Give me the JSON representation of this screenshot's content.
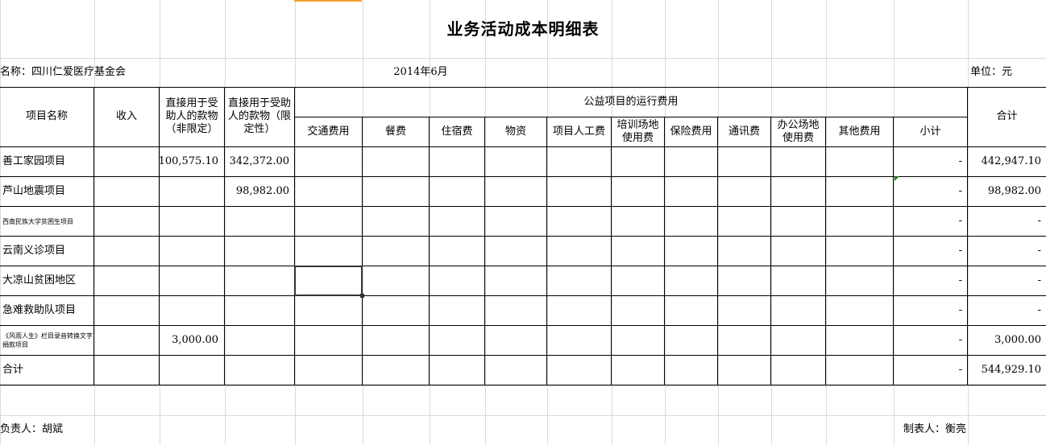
{
  "title": "业务活动成本明细表",
  "org_label": "名称：四川仁爱医疗基金会",
  "period": "2014年6月",
  "unit_label": "单位：元",
  "headers": {
    "project_name": "项目名称",
    "income": "收入",
    "direct_unrestricted": "直接用于受助人的款物（非限定）",
    "direct_restricted": "直接用于受助人的款物（限定性）",
    "operating_group": "公益项目的运行费用",
    "total": "合计",
    "sub": [
      "交通费用",
      "餐费",
      "住宿费",
      "物资",
      "项目人工费",
      "培训场地使用费",
      "保险费用",
      "通讯费",
      "办公场地使用费",
      "其他费用",
      "小计"
    ]
  },
  "rows": [
    {
      "name": "善工家园项目",
      "small": false,
      "direct_unrestricted": "100,575.10",
      "direct_restricted": "342,372.00",
      "subtotal": "-",
      "total": "442,947.10"
    },
    {
      "name": "芦山地震项目",
      "small": false,
      "direct_unrestricted": "",
      "direct_restricted": "98,982.00",
      "subtotal": "-",
      "total": "98,982.00"
    },
    {
      "name": "西南民族大学贫困生项目",
      "small": true,
      "direct_unrestricted": "",
      "direct_restricted": "",
      "subtotal": "-",
      "total": "-"
    },
    {
      "name": "云南义诊项目",
      "small": false,
      "direct_unrestricted": "",
      "direct_restricted": "",
      "subtotal": "-",
      "total": "-"
    },
    {
      "name": "大凉山贫困地区",
      "small": false,
      "direct_unrestricted": "",
      "direct_restricted": "",
      "subtotal": "-",
      "total": "-"
    },
    {
      "name": "急难救助队项目",
      "small": false,
      "direct_unrestricted": "",
      "direct_restricted": "",
      "subtotal": "-",
      "total": "-"
    },
    {
      "name": "《风雨人生》栏目录音转换文字捐款项目",
      "small": true,
      "direct_unrestricted": "3,000.00",
      "direct_restricted": "",
      "subtotal": "-",
      "total": "3,000.00"
    },
    {
      "name": "合计",
      "small": false,
      "direct_unrestricted": "",
      "direct_restricted": "",
      "subtotal": "-",
      "total": "544,929.10"
    }
  ],
  "footer": {
    "responsible": "负责人：胡斌",
    "preparer": "制表人：衡亮"
  },
  "colors": {
    "selection": "#333333",
    "grid": "#dadada",
    "accent": "#f0a030",
    "comment_marker": "#1a7a1a"
  }
}
